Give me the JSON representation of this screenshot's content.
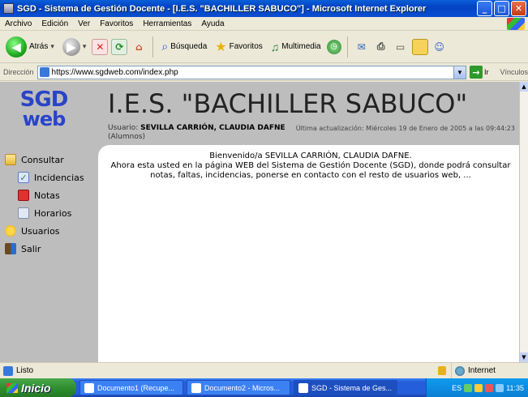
{
  "window": {
    "title": "SGD - Sistema de Gestión Docente - [I.E.S. \"BACHILLER SABUCO\"] - Microsoft Internet Explorer"
  },
  "menu": [
    "Archivo",
    "Edición",
    "Ver",
    "Favoritos",
    "Herramientas",
    "Ayuda"
  ],
  "toolbar": {
    "back": "Atrás",
    "search": "Búsqueda",
    "favorites": "Favoritos",
    "multimedia": "Multimedia"
  },
  "address": {
    "label": "Dirección",
    "url": "https://www.sgdweb.com/index.php",
    "go": "Ir",
    "links": "Vínculos"
  },
  "page": {
    "logo_top": "SGD",
    "logo_bottom": "web",
    "school": "I.E.S. \"BACHILLER SABUCO\"",
    "user_prefix": "Usuario:",
    "user_name": "SEVILLA CARRIÓN, CLAUDIA DAFNE",
    "user_role": "(Alumnos)",
    "last_update": "Última actualización: Miércoles 19 de Enero de 2005 a las 09:44:23",
    "welcome_line1": "Bienvenido/a SEVILLA CARRIÓN, CLAUDIA DAFNE.",
    "welcome_line2": "Ahora esta usted en la página WEB del Sistema de Gestión Docente (SGD), donde podrá consultar notas, faltas, incidencias, ponerse en contacto con el resto de usuarios web, ..."
  },
  "nav": {
    "consultar": "Consultar",
    "incidencias": "Incidencias",
    "notas": "Notas",
    "horarios": "Horarios",
    "usuarios": "Usuarios",
    "salir": "Salir"
  },
  "status": {
    "done": "Listo",
    "zone": "Internet"
  },
  "taskbar": {
    "start": "Inicio",
    "tasks": [
      "Documento1 (Recupe...",
      "Documento2 - Micros...",
      "SGD - Sistema de Ges..."
    ],
    "lang": "ES",
    "clock": "11:35"
  }
}
